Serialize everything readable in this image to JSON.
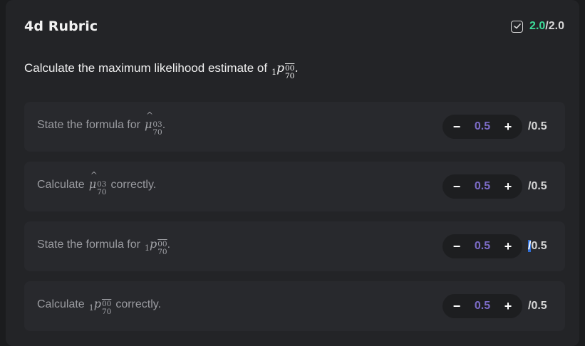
{
  "header": {
    "title": "4d Rubric",
    "score_earned": "2.0",
    "score_sep": "/",
    "score_total": "2.0"
  },
  "question": {
    "text": "Calculate the maximum likelihood estimate of",
    "math_pre": "1",
    "math_base": "p",
    "math_sup": "00",
    "math_sub": "70",
    "math_end": "."
  },
  "rows": [
    {
      "label_before": "State the formula for",
      "math_base": "μ",
      "math_sup": "03",
      "math_sub": "70",
      "label_after": ".",
      "minus": "−",
      "value": "0.5",
      "plus": "+",
      "max": "/0.5"
    },
    {
      "label_before": "Calculate",
      "math_base": "μ",
      "math_sup": "03",
      "math_sub": "70",
      "label_after": "correctly.",
      "minus": "−",
      "value": "0.5",
      "plus": "+",
      "max": "/0.5"
    },
    {
      "label_before": "State the formula for",
      "math_pre": "1",
      "math_base": "p",
      "math_sup": "00",
      "math_sub": "70",
      "label_after": ".",
      "minus": "−",
      "value": "0.5",
      "plus": "+",
      "max_sel": "/",
      "max_rest": "0.5"
    },
    {
      "label_before": "Calculate",
      "math_pre": "1",
      "math_base": "p",
      "math_sup": "00",
      "math_sub": "70",
      "label_after": "correctly.",
      "minus": "−",
      "value": "0.5",
      "plus": "+",
      "max": "/0.5"
    }
  ]
}
